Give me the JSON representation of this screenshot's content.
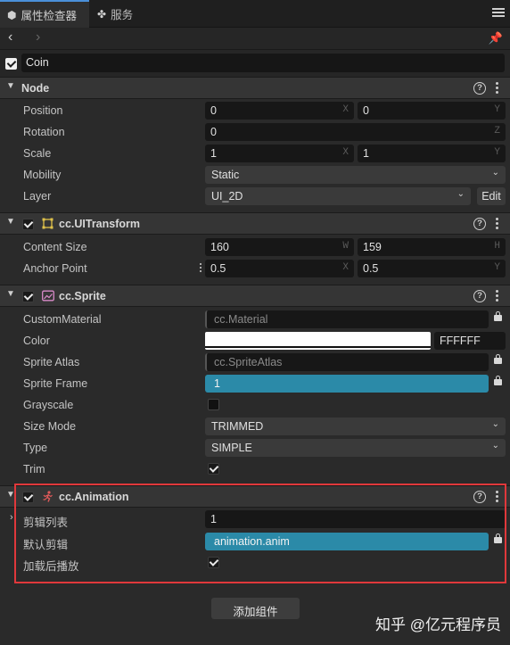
{
  "tabs": [
    {
      "label": "属性检查器",
      "icon": "inspector-icon"
    },
    {
      "label": "服务",
      "icon": "services-icon"
    }
  ],
  "node": {
    "active": true,
    "name": "Coin"
  },
  "sections": {
    "node": {
      "title": "Node",
      "position": {
        "x": "0",
        "y": "0",
        "x_axis": "X",
        "y_axis": "Y",
        "label": "Position"
      },
      "rotation": {
        "label": "Rotation",
        "value": "0",
        "axis": "Z"
      },
      "scale": {
        "label": "Scale",
        "x": "1",
        "y": "1",
        "x_axis": "X",
        "y_axis": "Y"
      },
      "mobility": {
        "label": "Mobility",
        "value": "Static"
      },
      "layer": {
        "label": "Layer",
        "value": "UI_2D",
        "edit": "Edit"
      }
    },
    "uitransform": {
      "title": "cc.UITransform",
      "content_size": {
        "label": "Content Size",
        "w": "160",
        "h": "159",
        "w_axis": "W",
        "h_axis": "H"
      },
      "anchor_point": {
        "label": "Anchor Point",
        "x": "0.5",
        "y": "0.5",
        "x_axis": "X",
        "y_axis": "Y"
      }
    },
    "sprite": {
      "title": "cc.Sprite",
      "custom_material": {
        "label": "CustomMaterial",
        "placeholder": "cc.Material"
      },
      "color": {
        "label": "Color",
        "hex": "FFFFFF",
        "swatch": "#ffffff"
      },
      "sprite_atlas": {
        "label": "Sprite Atlas",
        "placeholder": "cc.SpriteAtlas"
      },
      "sprite_frame": {
        "label": "Sprite Frame",
        "value": "1"
      },
      "grayscale": {
        "label": "Grayscale",
        "checked": false
      },
      "size_mode": {
        "label": "Size Mode",
        "value": "TRIMMED"
      },
      "type": {
        "label": "Type",
        "value": "SIMPLE"
      },
      "trim": {
        "label": "Trim",
        "checked": true
      }
    },
    "animation": {
      "title": "cc.Animation",
      "clips": {
        "label": "剪辑列表",
        "value": "1"
      },
      "default_clip": {
        "label": "默认剪辑",
        "value": "animation.anim"
      },
      "play_on_load": {
        "label": "加载后播放",
        "checked": true
      }
    }
  },
  "add_component": "添加组件",
  "watermark": "知乎 @亿元程序员",
  "colors": {
    "accent": "#2b8aa8",
    "highlight": "#e0383b",
    "tab_active": "#4a90d9"
  }
}
